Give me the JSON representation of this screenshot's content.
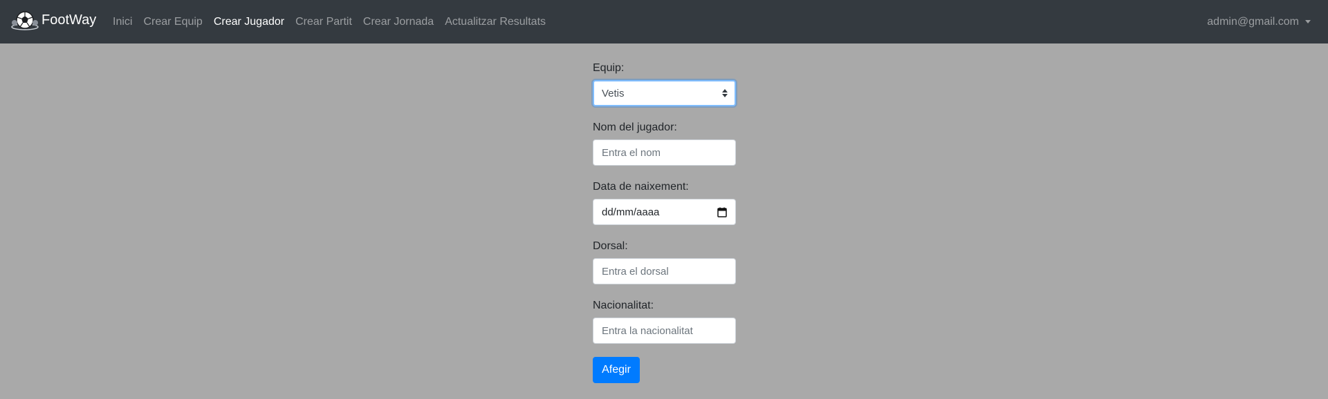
{
  "brand": {
    "name": "FootWay",
    "logo_icon": "soccer-ball-logo-icon"
  },
  "nav": {
    "items": [
      {
        "label": "Inici",
        "active": false
      },
      {
        "label": "Crear Equip",
        "active": false
      },
      {
        "label": "Crear Jugador",
        "active": true
      },
      {
        "label": "Crear Partit",
        "active": false
      },
      {
        "label": "Crear Jornada",
        "active": false
      },
      {
        "label": "Actualitzar Resultats",
        "active": false
      }
    ],
    "user": {
      "email": "admin@gmail.com",
      "dropdown_icon": "caret-down-icon"
    }
  },
  "form": {
    "team": {
      "label": "Equip:",
      "value": "Vetis"
    },
    "name": {
      "label": "Nom del jugador:",
      "placeholder": "Entra el nom",
      "value": ""
    },
    "birthdate": {
      "label": "Data de naixement:",
      "value": "dd/mm/aaaa",
      "icon": "calendar-icon"
    },
    "number": {
      "label": "Dorsal:",
      "placeholder": "Entra el dorsal",
      "value": ""
    },
    "nationality": {
      "label": "Nacionalitat:",
      "placeholder": "Entra la nacionalitat",
      "value": ""
    },
    "submit_label": "Afegir"
  },
  "colors": {
    "navbar_bg": "#343a40",
    "page_bg": "#a9a9a9",
    "primary": "#007bff",
    "focus_border": "#80bdff"
  }
}
